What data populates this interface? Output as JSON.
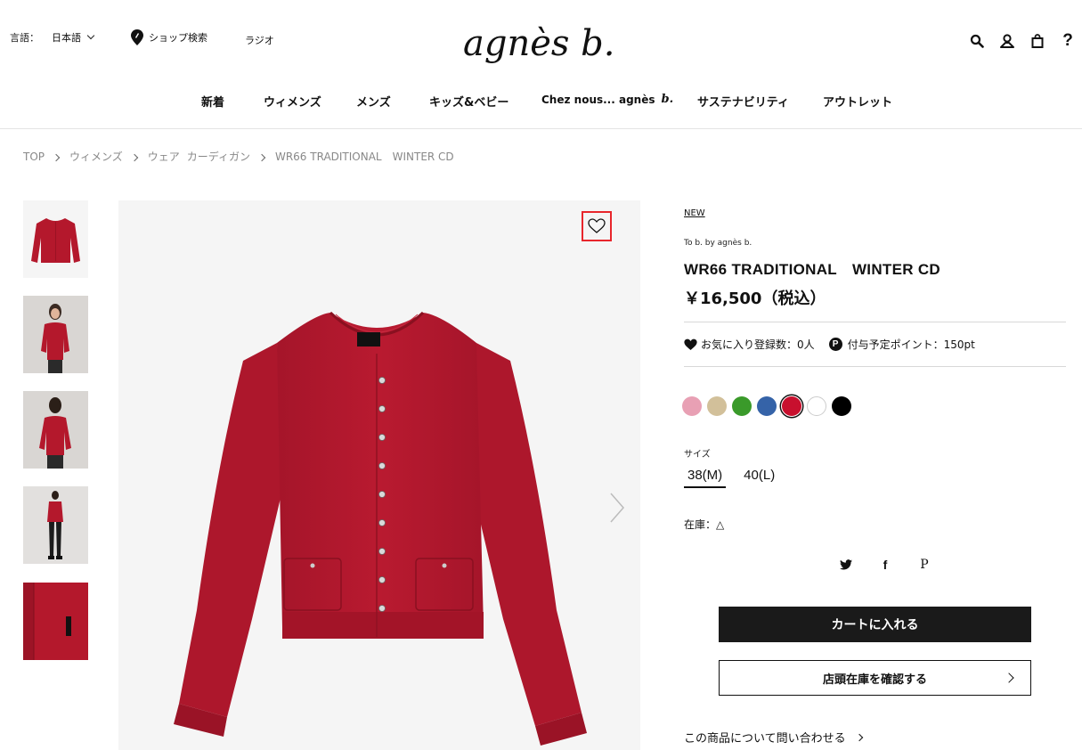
{
  "header": {
    "language_label": "言語：",
    "language_value": "日本語",
    "shop_search": "ショップ検索",
    "radio": "ラジオ",
    "logo_text": "agnès b.",
    "icons": [
      "search-icon",
      "account-icon",
      "bag-icon",
      "help-icon"
    ],
    "help_glyph": "?"
  },
  "nav": {
    "items": [
      "新着",
      "ウィメンズ",
      "メンズ",
      "キッズ&ベビー",
      "Chez nous... agnès",
      "サステナビリティ",
      "アウトレット"
    ],
    "b_mark": "b."
  },
  "breadcrumb": [
    "TOP",
    "ウィメンズ",
    "ウェア",
    "カーディガン",
    "WR66 TRADITIONAL　WINTER CD"
  ],
  "product": {
    "new_tag": "NEW",
    "brand": "To b. by agnès b.",
    "name": "WR66 TRADITIONAL　WINTER CD",
    "price": "￥16,500（税込）",
    "favorites": "お気に入り登録数：0人",
    "points_icon": "P",
    "points": "付与予定ポイント：150pt",
    "colors": [
      {
        "hex": "#e8a0b4",
        "selected": false
      },
      {
        "hex": "#d2c09a",
        "selected": false
      },
      {
        "hex": "#3a9a2a",
        "selected": false
      },
      {
        "hex": "#3563a8",
        "selected": false
      },
      {
        "hex": "#c8102e",
        "selected": true
      },
      {
        "hex": "#ffffff",
        "selected": false
      },
      {
        "hex": "#000000",
        "selected": false
      }
    ],
    "size_label": "サイズ",
    "sizes": [
      "38(M)",
      "40(L)"
    ],
    "selected_size": "38(M)",
    "stock": "在庫：△",
    "social": [
      "twitter-icon",
      "facebook-icon",
      "pinterest-icon"
    ],
    "social_glyphs": [
      "",
      "f",
      "P"
    ],
    "cart_button": "カートに入れる",
    "store_button": "店頭在庫を確認する",
    "inquiry": "この商品について問い合わせる"
  },
  "colors": {
    "garment": "#b4182c",
    "favorite_highlight": "#e8262c"
  }
}
